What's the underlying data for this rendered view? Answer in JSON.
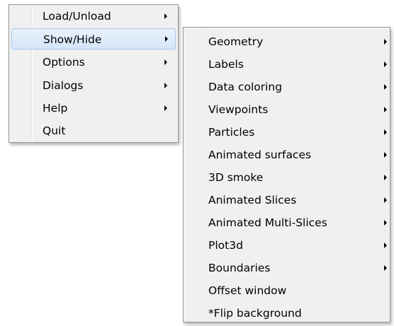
{
  "main_menu": {
    "items": [
      {
        "label": "Load/Unload",
        "has_submenu": true
      },
      {
        "label": "Show/Hide",
        "has_submenu": true
      },
      {
        "label": "Options",
        "has_submenu": true
      },
      {
        "label": "Dialogs",
        "has_submenu": true
      },
      {
        "label": "Help",
        "has_submenu": true
      },
      {
        "label": "Quit",
        "has_submenu": false
      }
    ]
  },
  "submenu": {
    "items": [
      {
        "label": "Geometry",
        "has_submenu": true
      },
      {
        "label": "Labels",
        "has_submenu": true
      },
      {
        "label": "Data coloring",
        "has_submenu": true
      },
      {
        "label": "Viewpoints",
        "has_submenu": true
      },
      {
        "label": "Particles",
        "has_submenu": true
      },
      {
        "label": "Animated surfaces",
        "has_submenu": true
      },
      {
        "label": "3D smoke",
        "has_submenu": true
      },
      {
        "label": "Animated Slices",
        "has_submenu": true
      },
      {
        "label": "Animated Multi-Slices",
        "has_submenu": true
      },
      {
        "label": "Plot3d",
        "has_submenu": true
      },
      {
        "label": "Boundaries",
        "has_submenu": true
      },
      {
        "label": "Offset window",
        "has_submenu": false
      },
      {
        "label": "*Flip background",
        "has_submenu": false
      }
    ]
  },
  "colors": {
    "menu_background": "#f0f0f0",
    "menu_border": "#979797",
    "highlight_fill": "#d9e8f9",
    "highlight_border": "#a8c8ee"
  },
  "icons": {
    "submenu_arrow": "submenu-arrow-icon"
  }
}
